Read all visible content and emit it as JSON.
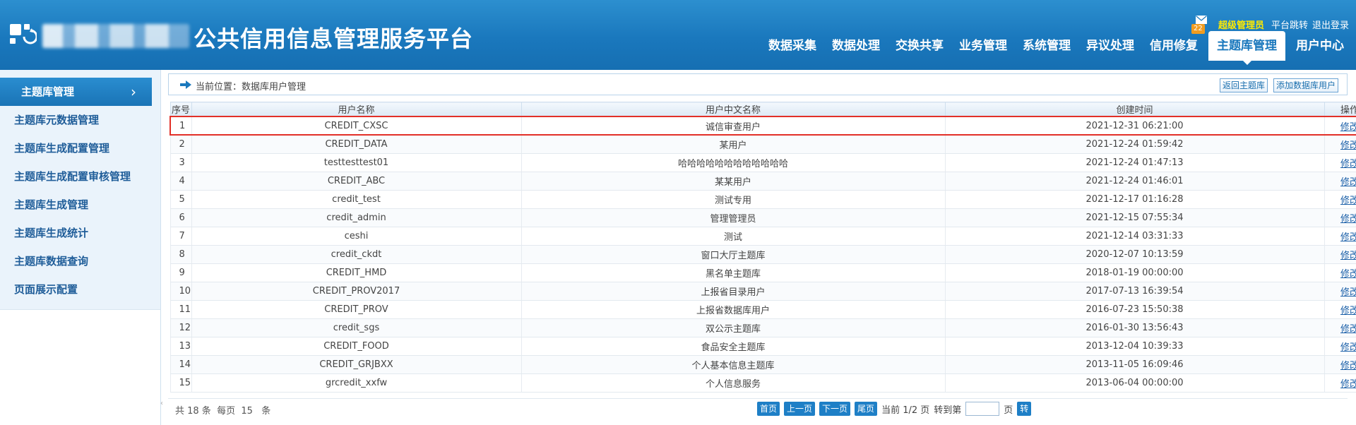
{
  "header": {
    "site_title": "公共信用信息管理服务平台",
    "mail_count": "22",
    "user": "超级管理员",
    "platform_jump": "平台跳转",
    "logout": "退出登录"
  },
  "nav": [
    {
      "label": "数据采集"
    },
    {
      "label": "数据处理"
    },
    {
      "label": "交换共享"
    },
    {
      "label": "业务管理"
    },
    {
      "label": "系统管理"
    },
    {
      "label": "异议处理"
    },
    {
      "label": "信用修复"
    },
    {
      "label": "主题库管理",
      "active": true
    },
    {
      "label": "用户中心"
    }
  ],
  "sidebar": {
    "title": "主题库管理",
    "items": [
      {
        "label": "主题库元数据管理"
      },
      {
        "label": "主题库生成配置管理"
      },
      {
        "label": "主题库生成配置审核管理"
      },
      {
        "label": "主题库生成管理"
      },
      {
        "label": "主题库生成统计"
      },
      {
        "label": "主题库数据查询"
      },
      {
        "label": "页面展示配置"
      }
    ]
  },
  "breadcrumb": {
    "text": "当前位置：数据库用户管理",
    "back_button": "返回主题库",
    "add_button": "添加数据库用户"
  },
  "table": {
    "columns": [
      "序号",
      "用户名称",
      "用户中文名称",
      "创建时间",
      "操作"
    ],
    "rows": [
      {
        "no": "1",
        "name": "CREDIT_CXSC",
        "cn_name": "诚信审查用户",
        "created": "2021-12-31 06:21:00",
        "action": "修改",
        "selected": true
      },
      {
        "no": "2",
        "name": "CREDIT_DATA",
        "cn_name": "某用户",
        "created": "2021-12-24 01:59:42",
        "action": "修改"
      },
      {
        "no": "3",
        "name": "testtesttest01",
        "cn_name": "哈哈哈哈哈哈哈哈哈哈哈哈",
        "created": "2021-12-24 01:47:13",
        "action": "修改"
      },
      {
        "no": "4",
        "name": "CREDIT_ABC",
        "cn_name": "某某用户",
        "created": "2021-12-24 01:46:01",
        "action": "修改"
      },
      {
        "no": "5",
        "name": "credit_test",
        "cn_name": "测试专用",
        "created": "2021-12-17 01:16:28",
        "action": "修改"
      },
      {
        "no": "6",
        "name": "credit_admin",
        "cn_name": "管理管理员",
        "created": "2021-12-15 07:55:34",
        "action": "修改"
      },
      {
        "no": "7",
        "name": "ceshi",
        "cn_name": "测试",
        "created": "2021-12-14 03:31:33",
        "action": "修改"
      },
      {
        "no": "8",
        "name": "credit_ckdt",
        "cn_name": "窗口大厅主题库",
        "created": "2020-12-07 10:13:59",
        "action": "修改"
      },
      {
        "no": "9",
        "name": "CREDIT_HMD",
        "cn_name": "黑名单主题库",
        "created": "2018-01-19 00:00:00",
        "action": "修改"
      },
      {
        "no": "10",
        "name": "CREDIT_PROV2017",
        "cn_name": "上报省目录用户",
        "created": "2017-07-13 16:39:54",
        "action": "修改"
      },
      {
        "no": "11",
        "name": "CREDIT_PROV",
        "cn_name": "上报省数据库用户",
        "created": "2016-07-23 15:50:38",
        "action": "修改"
      },
      {
        "no": "12",
        "name": "credit_sgs",
        "cn_name": "双公示主题库",
        "created": "2016-01-30 13:56:43",
        "action": "修改"
      },
      {
        "no": "13",
        "name": "CREDIT_FOOD",
        "cn_name": "食品安全主题库",
        "created": "2013-12-04 10:39:33",
        "action": "修改"
      },
      {
        "no": "14",
        "name": "CREDIT_GRJBXX",
        "cn_name": "个人基本信息主题库",
        "created": "2013-11-05 16:09:46",
        "action": "修改"
      },
      {
        "no": "15",
        "name": "grcredit_xxfw",
        "cn_name": "个人信息服务",
        "created": "2013-06-04 00:00:00",
        "action": "修改"
      }
    ]
  },
  "pager": {
    "summary": "共 18 条  每页  15   条",
    "first": "首页",
    "prev": "上一页",
    "next": "下一页",
    "last": "尾页",
    "current": "当前 1/2 页",
    "goto_label": "转到第",
    "page_unit": "页",
    "go": "转",
    "goto_value": ""
  },
  "colors": {
    "header_blue": "#1a78bd",
    "selected_outline": "#e23028",
    "username_highlight": "#ffea00"
  }
}
